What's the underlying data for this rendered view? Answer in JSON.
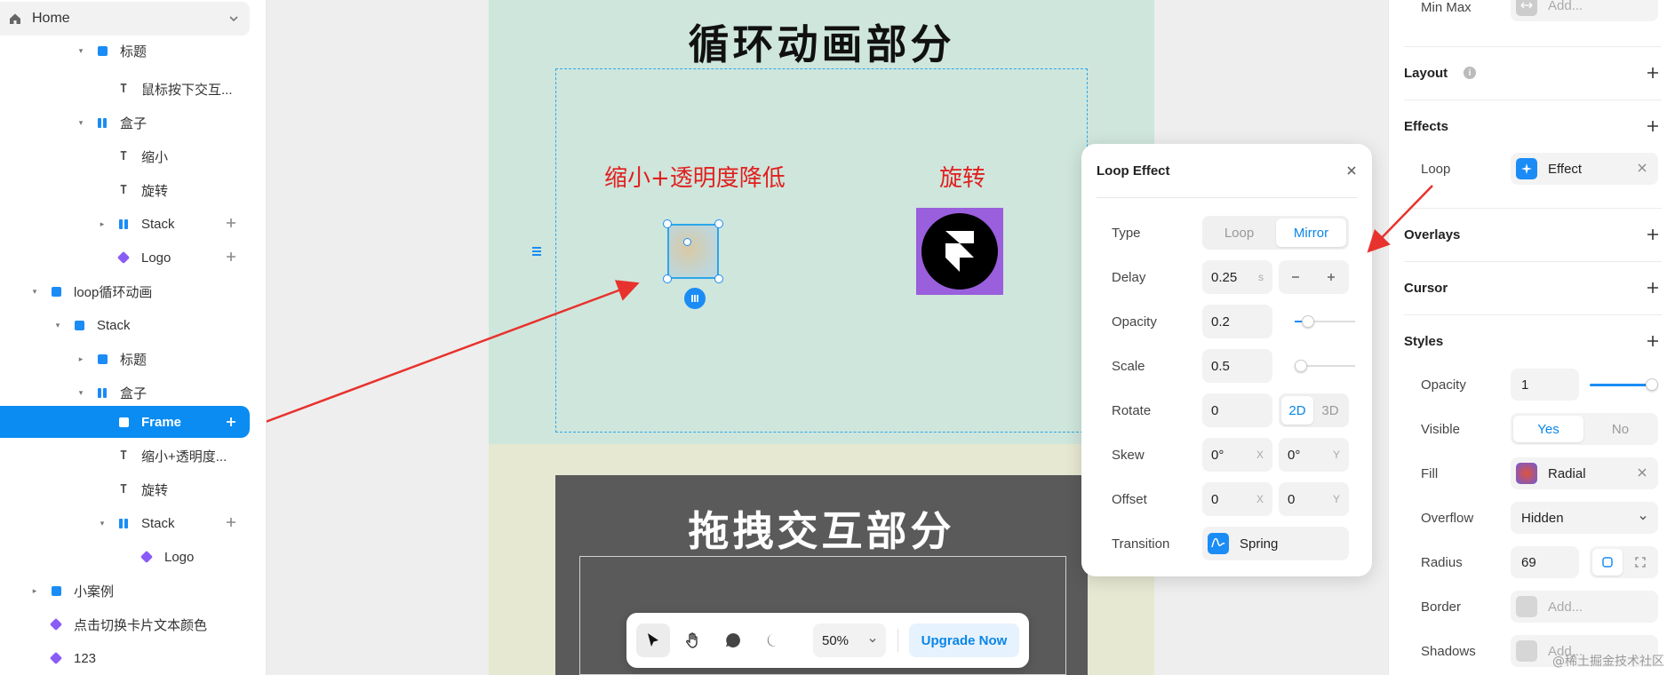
{
  "layers": {
    "home_label": "Home",
    "items": [
      {
        "label": "标题",
        "icon": "stack-icon"
      },
      {
        "label": "鼠标按下交互...",
        "icon": "text-icon"
      },
      {
        "label": "盒子",
        "icon": "stack-vertical-icon"
      },
      {
        "label": "缩小",
        "icon": "text-icon"
      },
      {
        "label": "旋转",
        "icon": "text-icon"
      },
      {
        "label": "Stack",
        "icon": "stack-vertical-icon"
      },
      {
        "label": "Logo",
        "icon": "component-icon"
      },
      {
        "label": "loop循环动画",
        "icon": "stack-icon"
      },
      {
        "label": "Stack",
        "icon": "stack-icon"
      },
      {
        "label": "标题",
        "icon": "stack-icon"
      },
      {
        "label": "盒子",
        "icon": "stack-vertical-icon"
      },
      {
        "label": "Frame",
        "icon": "frame-icon"
      },
      {
        "label": "缩小+透明度...",
        "icon": "text-icon"
      },
      {
        "label": "旋转",
        "icon": "text-icon"
      },
      {
        "label": "Stack",
        "icon": "stack-vertical-icon"
      },
      {
        "label": "Logo",
        "icon": "component-icon"
      },
      {
        "label": "小案例",
        "icon": "stack-icon"
      },
      {
        "label": "点击切换卡片文本颜色",
        "icon": "component-icon"
      },
      {
        "label": "123",
        "icon": "component-icon"
      }
    ]
  },
  "canvas": {
    "title1": "循环动画部分",
    "label_scale_opacity": "缩小+透明度降低",
    "label_rotate": "旋转",
    "title2": "拖拽交互部分",
    "page_color": "#cfe6dc",
    "accent": "#2ca6ea"
  },
  "toolbar": {
    "zoom": "50%",
    "upgrade": "Upgrade Now"
  },
  "loop_effect": {
    "title": "Loop Effect",
    "type_label": "Type",
    "type_options": [
      "Loop",
      "Mirror"
    ],
    "type_selected": "Mirror",
    "delay_label": "Delay",
    "delay_value": "0.25",
    "delay_unit": "s",
    "opacity_label": "Opacity",
    "opacity_value": "0.2",
    "scale_label": "Scale",
    "scale_value": "0.5",
    "rotate_label": "Rotate",
    "rotate_value": "0",
    "rotate_modes": [
      "2D",
      "3D"
    ],
    "rotate_mode_selected": "2D",
    "skew_label": "Skew",
    "skew_x": "0°",
    "skew_y": "0°",
    "axis_x": "X",
    "axis_y": "Y",
    "offset_label": "Offset",
    "offset_x": "0",
    "offset_y": "0",
    "transition_label": "Transition",
    "transition_value": "Spring"
  },
  "properties": {
    "minmax_label": "Min Max",
    "minmax_placeholder": "Add...",
    "layout_title": "Layout",
    "effects_title": "Effects",
    "loop_label": "Loop",
    "loop_effect_value": "Effect",
    "overlays_title": "Overlays",
    "cursor_title": "Cursor",
    "styles_title": "Styles",
    "opacity_label": "Opacity",
    "opacity_value": "1",
    "visible_label": "Visible",
    "visible_yes": "Yes",
    "visible_no": "No",
    "fill_label": "Fill",
    "fill_value": "Radial",
    "overflow_label": "Overflow",
    "overflow_value": "Hidden",
    "radius_label": "Radius",
    "radius_value": "69",
    "border_label": "Border",
    "border_placeholder": "Add...",
    "shadows_label": "Shadows",
    "shadows_placeholder": "Add..."
  },
  "watermark": "@稀土掘金技术社区"
}
